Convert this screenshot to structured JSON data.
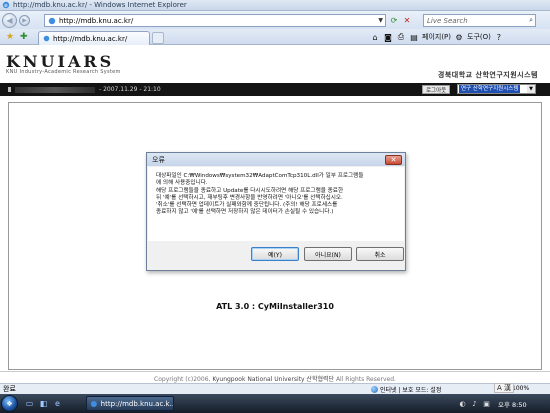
{
  "window": {
    "title": "http://mdb.knu.ac.kr/ - Windows Internet Explorer"
  },
  "toolbar": {
    "address_url": "http://mdb.knu.ac.kr/",
    "search_placeholder": "Live Search"
  },
  "tabs": [
    {
      "label": "http://mdb.knu.ac.kr/"
    }
  ],
  "commandbar": {
    "page_label": "페이지(P)",
    "tools_label": "도구(O)"
  },
  "site": {
    "logo": "KNUIARS",
    "logo_sub": "KNU Industry-Academic Research System",
    "university": "경북대학교 산학연구지원시스템",
    "datetime": "- 2007.11.29 - 21:10",
    "logout_label": "로그아웃",
    "system_select": "연구 산학연구지원시스템",
    "atl_text": "ATL 3.0 : CyMiInstaller310",
    "copyright_prefix": "Copyright (c)2006,",
    "copyright_org": "Kyungpook National University 산학협력단",
    "copyright_suffix": "All Rights Reserved."
  },
  "dialog": {
    "title": "오류",
    "message_lines": [
      "대상파일인 C:₩Windows₩system32₩AdaptComTcp310L.dll가 일부 프로그램들",
      "에 의해 사용중입니다.",
      "해당 프로그램들을 종료하고 Update를 다시시도하려면 해당 프로그램을 종료한",
      "뒤 '예'를 선택하시고, 재부팅후 변경사항을 반영하려면 '아니오'를 선택하십시오.",
      "'취소'를 선택하면 업데이트가 실패와함께 중단됩니다. (주의! 해당 프로세스를",
      "종료하지 않고 '예'를 선택하면 저장하지 않은 데이터가 손실될 수 있습니다.)"
    ],
    "yes_label": "예(Y)",
    "no_label": "아니요(N)",
    "cancel_label": "취소"
  },
  "statusbar": {
    "status_text": "완료",
    "zone_text": "인터넷 | 보호 모드: 설정",
    "zoom_text": "100%"
  },
  "taskbar": {
    "window_button": "http://mdb.knu.ac.k...",
    "clock": "오후 8:50",
    "lang_indicator": "A 漢"
  }
}
